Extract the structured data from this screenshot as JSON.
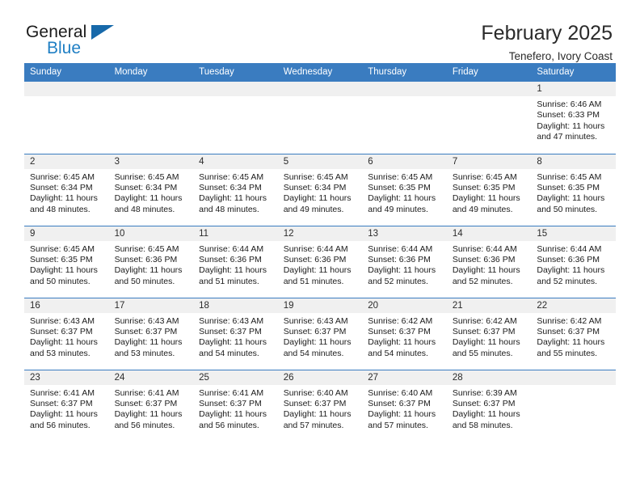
{
  "brand": {
    "word1": "General",
    "word2": "Blue",
    "logo_icon": "triangle-logo-icon",
    "accent_color": "#1f7fc4"
  },
  "header": {
    "title": "February 2025",
    "subtitle": "Tenefero, Ivory Coast"
  },
  "calendar": {
    "header_bg": "#3a7cc0",
    "daynum_bg": "#f0f0f0",
    "weekdays": [
      "Sunday",
      "Monday",
      "Tuesday",
      "Wednesday",
      "Thursday",
      "Friday",
      "Saturday"
    ],
    "weeks": [
      [
        {
          "day": "",
          "lines": []
        },
        {
          "day": "",
          "lines": []
        },
        {
          "day": "",
          "lines": []
        },
        {
          "day": "",
          "lines": []
        },
        {
          "day": "",
          "lines": []
        },
        {
          "day": "",
          "lines": []
        },
        {
          "day": "1",
          "lines": [
            "Sunrise: 6:46 AM",
            "Sunset: 6:33 PM",
            "Daylight: 11 hours",
            "and 47 minutes."
          ]
        }
      ],
      [
        {
          "day": "2",
          "lines": [
            "Sunrise: 6:45 AM",
            "Sunset: 6:34 PM",
            "Daylight: 11 hours",
            "and 48 minutes."
          ]
        },
        {
          "day": "3",
          "lines": [
            "Sunrise: 6:45 AM",
            "Sunset: 6:34 PM",
            "Daylight: 11 hours",
            "and 48 minutes."
          ]
        },
        {
          "day": "4",
          "lines": [
            "Sunrise: 6:45 AM",
            "Sunset: 6:34 PM",
            "Daylight: 11 hours",
            "and 48 minutes."
          ]
        },
        {
          "day": "5",
          "lines": [
            "Sunrise: 6:45 AM",
            "Sunset: 6:34 PM",
            "Daylight: 11 hours",
            "and 49 minutes."
          ]
        },
        {
          "day": "6",
          "lines": [
            "Sunrise: 6:45 AM",
            "Sunset: 6:35 PM",
            "Daylight: 11 hours",
            "and 49 minutes."
          ]
        },
        {
          "day": "7",
          "lines": [
            "Sunrise: 6:45 AM",
            "Sunset: 6:35 PM",
            "Daylight: 11 hours",
            "and 49 minutes."
          ]
        },
        {
          "day": "8",
          "lines": [
            "Sunrise: 6:45 AM",
            "Sunset: 6:35 PM",
            "Daylight: 11 hours",
            "and 50 minutes."
          ]
        }
      ],
      [
        {
          "day": "9",
          "lines": [
            "Sunrise: 6:45 AM",
            "Sunset: 6:35 PM",
            "Daylight: 11 hours",
            "and 50 minutes."
          ]
        },
        {
          "day": "10",
          "lines": [
            "Sunrise: 6:45 AM",
            "Sunset: 6:36 PM",
            "Daylight: 11 hours",
            "and 50 minutes."
          ]
        },
        {
          "day": "11",
          "lines": [
            "Sunrise: 6:44 AM",
            "Sunset: 6:36 PM",
            "Daylight: 11 hours",
            "and 51 minutes."
          ]
        },
        {
          "day": "12",
          "lines": [
            "Sunrise: 6:44 AM",
            "Sunset: 6:36 PM",
            "Daylight: 11 hours",
            "and 51 minutes."
          ]
        },
        {
          "day": "13",
          "lines": [
            "Sunrise: 6:44 AM",
            "Sunset: 6:36 PM",
            "Daylight: 11 hours",
            "and 52 minutes."
          ]
        },
        {
          "day": "14",
          "lines": [
            "Sunrise: 6:44 AM",
            "Sunset: 6:36 PM",
            "Daylight: 11 hours",
            "and 52 minutes."
          ]
        },
        {
          "day": "15",
          "lines": [
            "Sunrise: 6:44 AM",
            "Sunset: 6:36 PM",
            "Daylight: 11 hours",
            "and 52 minutes."
          ]
        }
      ],
      [
        {
          "day": "16",
          "lines": [
            "Sunrise: 6:43 AM",
            "Sunset: 6:37 PM",
            "Daylight: 11 hours",
            "and 53 minutes."
          ]
        },
        {
          "day": "17",
          "lines": [
            "Sunrise: 6:43 AM",
            "Sunset: 6:37 PM",
            "Daylight: 11 hours",
            "and 53 minutes."
          ]
        },
        {
          "day": "18",
          "lines": [
            "Sunrise: 6:43 AM",
            "Sunset: 6:37 PM",
            "Daylight: 11 hours",
            "and 54 minutes."
          ]
        },
        {
          "day": "19",
          "lines": [
            "Sunrise: 6:43 AM",
            "Sunset: 6:37 PM",
            "Daylight: 11 hours",
            "and 54 minutes."
          ]
        },
        {
          "day": "20",
          "lines": [
            "Sunrise: 6:42 AM",
            "Sunset: 6:37 PM",
            "Daylight: 11 hours",
            "and 54 minutes."
          ]
        },
        {
          "day": "21",
          "lines": [
            "Sunrise: 6:42 AM",
            "Sunset: 6:37 PM",
            "Daylight: 11 hours",
            "and 55 minutes."
          ]
        },
        {
          "day": "22",
          "lines": [
            "Sunrise: 6:42 AM",
            "Sunset: 6:37 PM",
            "Daylight: 11 hours",
            "and 55 minutes."
          ]
        }
      ],
      [
        {
          "day": "23",
          "lines": [
            "Sunrise: 6:41 AM",
            "Sunset: 6:37 PM",
            "Daylight: 11 hours",
            "and 56 minutes."
          ]
        },
        {
          "day": "24",
          "lines": [
            "Sunrise: 6:41 AM",
            "Sunset: 6:37 PM",
            "Daylight: 11 hours",
            "and 56 minutes."
          ]
        },
        {
          "day": "25",
          "lines": [
            "Sunrise: 6:41 AM",
            "Sunset: 6:37 PM",
            "Daylight: 11 hours",
            "and 56 minutes."
          ]
        },
        {
          "day": "26",
          "lines": [
            "Sunrise: 6:40 AM",
            "Sunset: 6:37 PM",
            "Daylight: 11 hours",
            "and 57 minutes."
          ]
        },
        {
          "day": "27",
          "lines": [
            "Sunrise: 6:40 AM",
            "Sunset: 6:37 PM",
            "Daylight: 11 hours",
            "and 57 minutes."
          ]
        },
        {
          "day": "28",
          "lines": [
            "Sunrise: 6:39 AM",
            "Sunset: 6:37 PM",
            "Daylight: 11 hours",
            "and 58 minutes."
          ]
        },
        {
          "day": "",
          "lines": []
        }
      ]
    ]
  }
}
